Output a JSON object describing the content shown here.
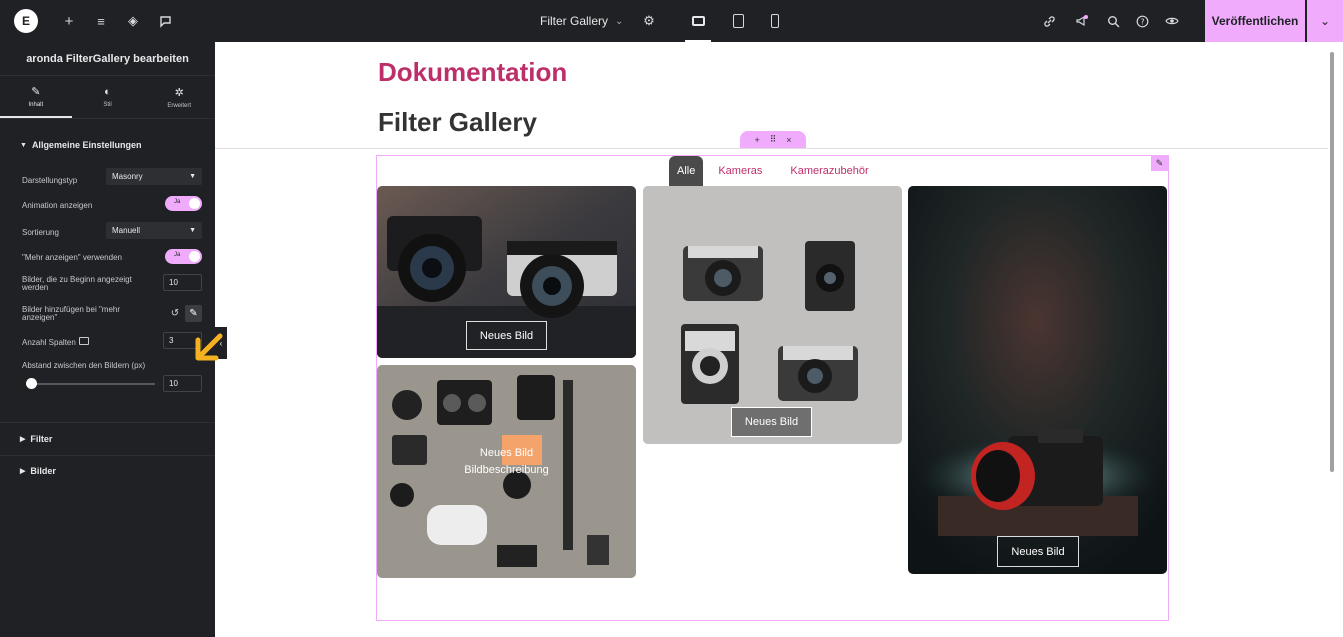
{
  "topbar": {
    "document_title": "Filter Gallery",
    "publish_label": "Veröffentlichen",
    "icons": [
      "elementor-logo-icon",
      "plus-icon",
      "structure-icon",
      "layers-icon",
      "chat-icon",
      "settings-icon",
      "desktop-icon",
      "tablet-icon",
      "mobile-icon",
      "link-icon",
      "megaphone-icon",
      "search-icon",
      "help-icon",
      "preview-eye-icon",
      "chevron-down-icon"
    ]
  },
  "panel": {
    "title": "aronda FilterGallery bearbeiten",
    "tabs": [
      {
        "label": "Inhalt",
        "icon": "pencil-icon"
      },
      {
        "label": "Stil",
        "icon": "contrast-icon"
      },
      {
        "label": "Erweitert",
        "icon": "gear-icon"
      }
    ],
    "section_general": "Allgemeine Einstellungen",
    "controls": {
      "display_type_label": "Darstellungstyp",
      "display_type_value": "Masonry",
      "animation_label": "Animation anzeigen",
      "animation_value": "Ja",
      "sort_label": "Sortierung",
      "sort_value": "Manuell",
      "more_label": "\"Mehr anzeigen\" verwenden",
      "more_value": "Ja",
      "initial_label": "Bilder, die zu Beginn angezeigt werden",
      "initial_value": "10",
      "add_more_label": "Bilder hinzufügen bei \"mehr anzeigen\"",
      "columns_label": "Anzahl Spalten",
      "columns_value": "3",
      "gap_label": "Abstand zwischen den Bildern (px)",
      "gap_value": "10",
      "gap_slider_fraction": 0
    },
    "section_filter": "Filter",
    "section_images": "Bilder"
  },
  "canvas": {
    "heading_doc": "Dokumentation",
    "heading_gallery": "Filter Gallery",
    "filters": [
      {
        "label": "Alle",
        "active": true
      },
      {
        "label": "Kameras",
        "active": false
      },
      {
        "label": "Kamerazubehör",
        "active": false
      }
    ],
    "images": [
      {
        "caption": "Neues Bild"
      },
      {
        "caption": "Neues Bild"
      },
      {
        "caption": "Neues Bild"
      },
      {
        "caption": "Neues Bild",
        "description": "Bildbeschreibung"
      }
    ]
  },
  "colors": {
    "accent_pink": "#f0abfc",
    "heading_pink": "#bd2f6a",
    "panel_bg": "#1f2124",
    "arrow_yellow": "#f5b11f"
  }
}
